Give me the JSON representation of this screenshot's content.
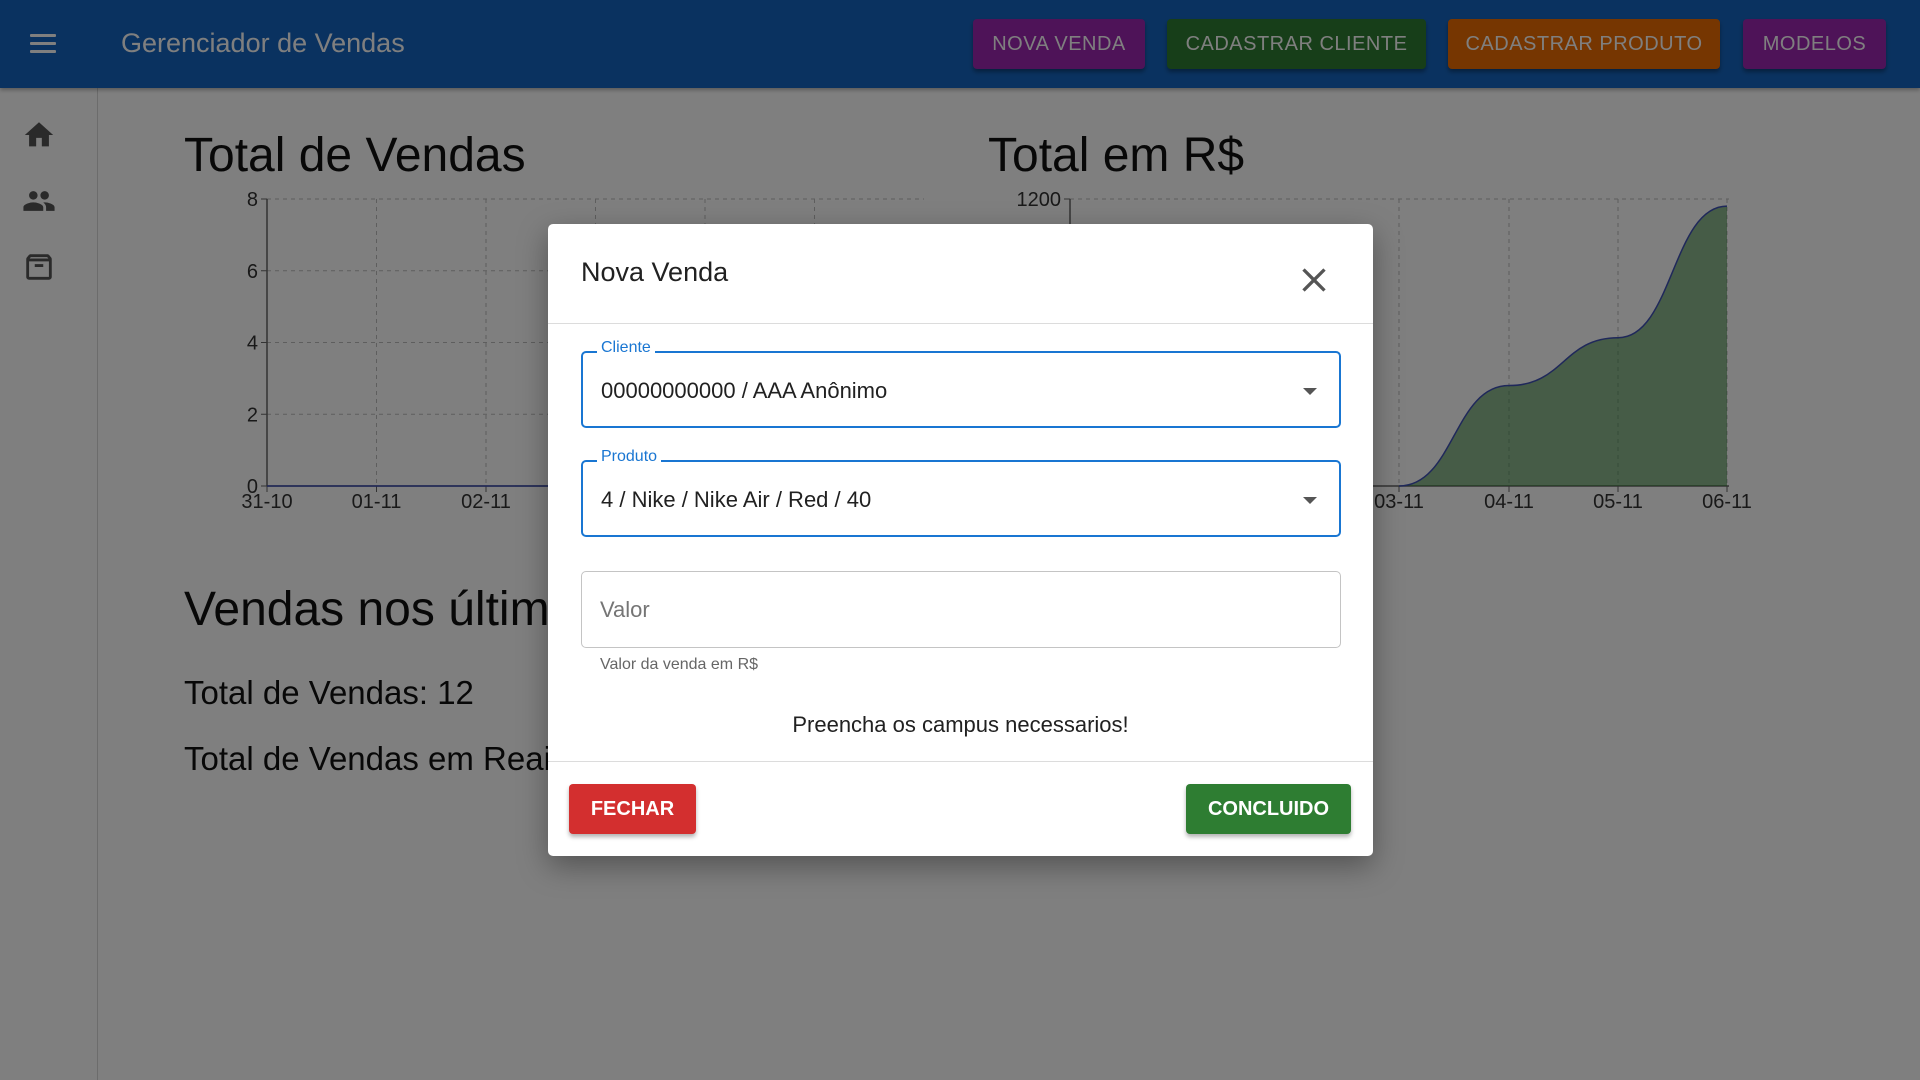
{
  "appbar": {
    "title": "Gerenciador de Vendas",
    "buttons": [
      {
        "label": "NOVA VENDA",
        "color": "#9c27b0"
      },
      {
        "label": "CADASTRAR CLIENTE",
        "color": "#2e7d32"
      },
      {
        "label": "CADASTRAR PRODUTO",
        "color": "#ed6c02"
      },
      {
        "label": "MODELOS",
        "color": "#9c27b0"
      }
    ],
    "color": "#1565c0"
  },
  "sidebar": {
    "icons": [
      "home-icon",
      "people-icon",
      "archive-icon"
    ]
  },
  "main": {
    "chart1_title": "Total de Vendas",
    "chart2_title": "Total em R$",
    "section_title": "Vendas nos últim",
    "total_vendas": "Total de Vendas: 12",
    "total_reais": "Total de Vendas em Reai"
  },
  "chart_data": [
    {
      "type": "line",
      "title": "Total de Vendas",
      "x": [
        "31-10",
        "01-11",
        "02-11"
      ],
      "ylim": [
        0,
        8
      ],
      "yticks": [
        0,
        2,
        4,
        6,
        8
      ],
      "grid": true
    },
    {
      "type": "area",
      "title": "Total em R$",
      "x": [
        "03-11",
        "04-11",
        "05-11",
        "06-11"
      ],
      "series": [
        {
          "values": [
            0,
            420,
            620,
            1170
          ]
        }
      ],
      "ylim": [
        0,
        1200
      ],
      "yticks": [
        1200
      ],
      "grid": true,
      "fill_color": "#2e7d32"
    }
  ],
  "dialog": {
    "title": "Nova Venda",
    "cliente_label": "Cliente",
    "cliente_value": "00000000000 / AAA Anônimo",
    "produto_label": "Produto",
    "produto_value": "4 / Nike / Nike Air / Red / 40",
    "valor_placeholder": "Valor",
    "valor_helper": "Valor da venda em R$",
    "warning": "Preencha os campus necessarios!",
    "fechar_label": "FECHAR",
    "fechar_color": "#d32f2f",
    "concluido_label": "CONCLUIDO",
    "concluido_color": "#2e7d32"
  }
}
